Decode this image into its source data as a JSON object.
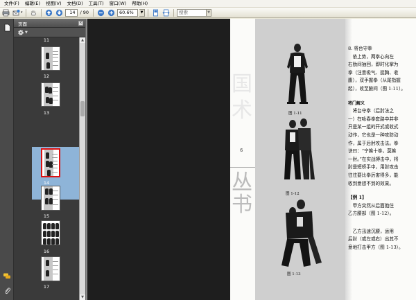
{
  "menu": [
    "文件(F)",
    "编辑(E)",
    "视图(V)",
    "文档(D)",
    "工具(T)",
    "窗口(W)",
    "帮助(H)"
  ],
  "toolbar": {
    "page_current": "14",
    "page_total": "/ 90",
    "zoom_value": "60.6%",
    "find_placeholder": "搜索"
  },
  "panel": {
    "title": "页面"
  },
  "thumbnails": [
    {
      "label": "11"
    },
    {
      "label": "12"
    },
    {
      "label": "13"
    },
    {
      "label": "14"
    },
    {
      "label": "15"
    },
    {
      "label": "16"
    },
    {
      "label": "17"
    }
  ],
  "selected_page": "14",
  "page_content": {
    "margin_number": "6",
    "side_chars": [
      "国",
      "术",
      "丛",
      "书"
    ],
    "text_block_1": "8. 将台守拳\n　依上势，两拳心向左\n右肋间抽回，即时化掌为\n拳（注意吸气、挺胸、收\n腹），双手握拳（从尾指握\n起），收至腋间（图 1-11）。",
    "section_head": "将门解义",
    "text_block_2": "　将台守拳（后肘法之\n一）在咏春拳套路中并非\n只是某一组的开式或收式\n动作，它也是一种攻防动\n作，属于后肘攻击法。拳\n诀曰：“宁挨十拳，莫挨\n一肘。”在实战搏击中，将\n肘是短桥手中，用肘攻击\n往往要比拳厉害得多，能\n收到意想不到的效果。",
    "example_head": "【例 1】",
    "text_block_3": "　甲方突然从后面抱住\n乙方腰部（图 1-12）。",
    "text_block_4": "　乙方迅速沉腰，运用\n后肘（或左或右）出其不\n意地打击甲方（图 1-13）。",
    "fig_caption_1": "图 1-11",
    "fig_caption_2": "图 1-12",
    "fig_caption_3": "图 1-13"
  }
}
